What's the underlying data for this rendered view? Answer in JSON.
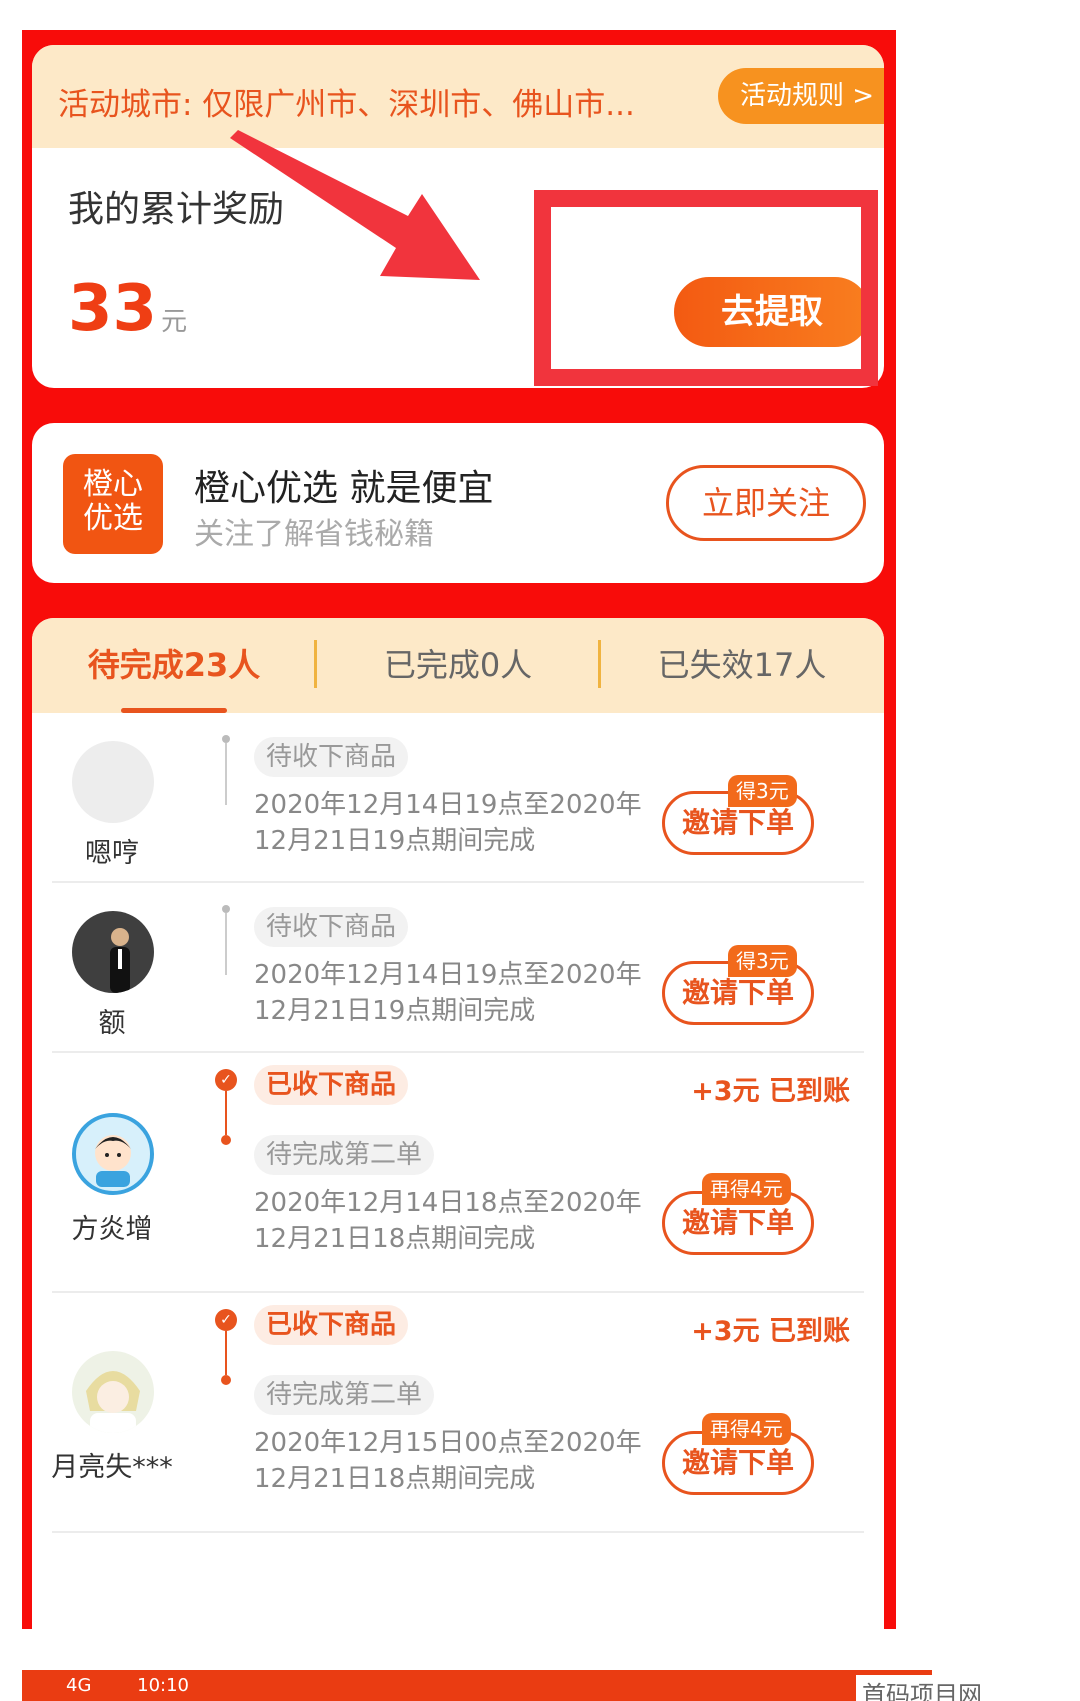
{
  "campaign": {
    "city_notice": "活动城市: 仅限广州市、深圳市、佛山市...",
    "rules_label": "活动规则 >",
    "reward_label": "我的累计奖励",
    "reward_amount": "33",
    "reward_unit": "元",
    "withdraw_label": "去提取"
  },
  "follow": {
    "logo_line1": "橙心",
    "logo_line2": "优选",
    "title": "橙心优选 就是便宜",
    "subtitle": "关注了解省钱秘籍",
    "button_label": "立即关注"
  },
  "tabs": [
    {
      "label": "待完成23人",
      "active": true
    },
    {
      "label": "已完成0人",
      "active": false
    },
    {
      "label": "已失效17人",
      "active": false
    }
  ],
  "invitees": [
    {
      "name": "嗯哼",
      "status": "待收下商品",
      "period": "2020年12月14日19点至2020年12月21日19点期间完成",
      "bonus": "得3元",
      "button": "邀请下单"
    },
    {
      "name": "额",
      "status": "待收下商品",
      "period": "2020年12月14日19点至2020年12月21日19点期间完成",
      "bonus": "得3元",
      "button": "邀请下单"
    },
    {
      "name": "方炎增",
      "status_done": "已收下商品",
      "credited": "+3元 已到账",
      "status": "待完成第二单",
      "period": "2020年12月14日18点至2020年12月21日18点期间完成",
      "bonus": "再得4元",
      "button": "邀请下单"
    },
    {
      "name": "月亮失***",
      "status_done": "已收下商品",
      "credited": "+3元 已到账",
      "status": "待完成第二单",
      "period": "2020年12月15日00点至2020年12月21日18点期间完成",
      "bonus": "再得4元",
      "button": "邀请下单"
    }
  ],
  "status_bar": {
    "network": "4G",
    "time": "10:10"
  },
  "watermark": "首码项目网"
}
